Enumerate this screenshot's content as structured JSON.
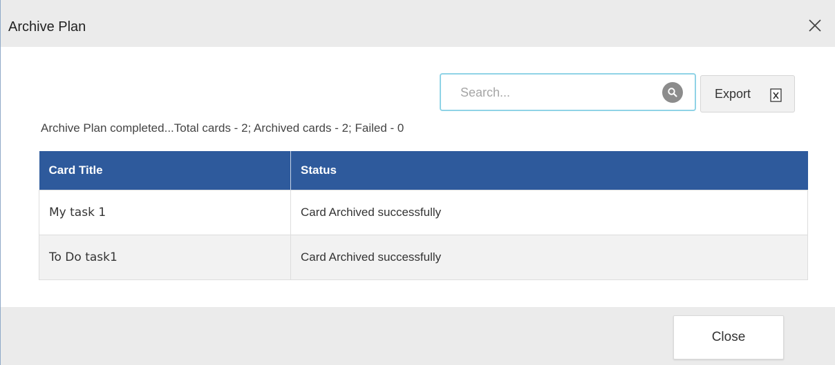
{
  "dialog": {
    "title": "Archive Plan",
    "close_icon": "close-icon"
  },
  "search": {
    "placeholder": "Search...",
    "value": "",
    "icon": "search-icon"
  },
  "export": {
    "label": "Export",
    "icon": "excel-icon"
  },
  "summary": "Archive Plan completed...Total cards - 2; Archived cards - 2; Failed - 0",
  "table": {
    "columns": [
      "Card Title",
      "Status"
    ],
    "rows": [
      [
        "My task 1",
        "Card Archived successfully"
      ],
      [
        "To Do task1",
        "Card Archived successfully"
      ]
    ]
  },
  "footer": {
    "close_label": "Close"
  },
  "colors": {
    "header_bg": "#2e5a9c",
    "titlebar_bg": "#ebebeb",
    "search_border": "#8fd3e6"
  }
}
